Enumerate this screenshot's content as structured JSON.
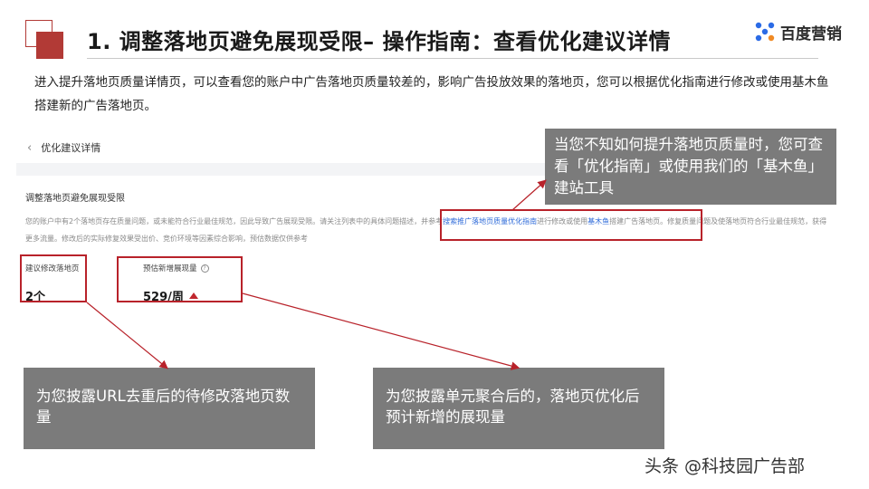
{
  "slide": {
    "title": "1. 调整落地页避免展现受限– 操作指南：查看优化建议详情",
    "logo_text": "百度营销",
    "intro": "进入提升落地页质量详情页，可以查看您的账户中广告落地页质量较差的，影响广告投放效果的落地页，您可以根据优化指南进行修改或使用基木鱼搭建新的广告落地页。",
    "accent_color": "#b23a36"
  },
  "panel": {
    "back_icon": "‹",
    "header": "优化建议详情",
    "subtitle": "调整落地页避免展现受限",
    "desc_part1": "您的账户中有2个落地页存在质量问题，或未能符合行业最佳规范，因此导致广告展现受限。请关注列表中的具体问题描述，",
    "desc_part2": "并参考",
    "desc_link1": "搜索推广落地页质量优化指南",
    "desc_part3": "进行修改或使用",
    "desc_link2": "基木鱼",
    "desc_part4": "搭建广告落地页。",
    "desc_part5": "修复质量问题及使落地页符合行业最佳规范，获得更多流量。修改后的实际修复效果受出价、竞价环境等因素综合影响，预估数据仅供参考",
    "metric1_label": "建议修改落地页",
    "metric1_value": "2个",
    "metric2_label": "预估新增展现量",
    "metric2_value": "529/周",
    "link_color": "#2f6bd9"
  },
  "callouts": {
    "top": "当您不知如何提升落地页质量时，您可查看「优化指南」或使用我们的「基木鱼」建站工具",
    "left": "为您披露URL去重后的待修改落地页数量",
    "right": "为您披露单元聚合后的，落地页优化后预计新增的展现量"
  },
  "watermark": "头条 @科技园广告部"
}
